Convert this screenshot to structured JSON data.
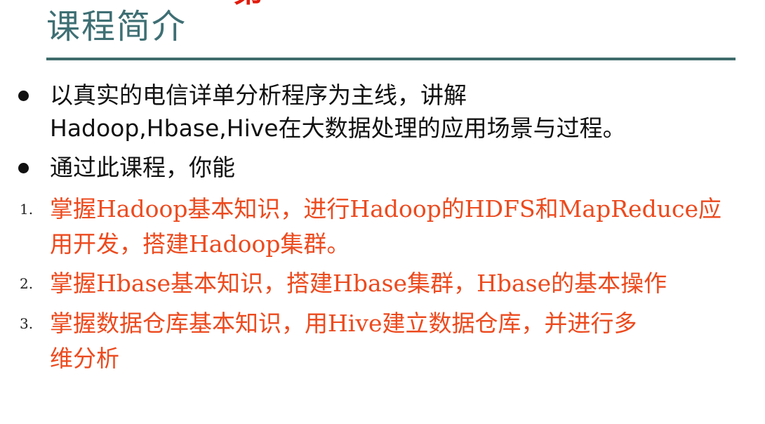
{
  "slide": {
    "top_fragment": "第一",
    "title": "课程简介",
    "bullets": [
      {
        "lines": [
          "以真实的电信详单分析程序为主线，讲解",
          "Hadoop,Hbase,Hive在大数据处理的应用场景与过程。"
        ]
      },
      {
        "lines": [
          "通过此课程，你能"
        ]
      }
    ],
    "numbered": [
      {
        "number": "1.",
        "lines": [
          "掌握Hadoop基本知识，进行Hadoop的HDFS和MapReduce应",
          "用开发，搭建Hadoop集群。"
        ]
      },
      {
        "number": "2.",
        "lines": [
          "掌握Hbase基本知识，搭建Hbase集群，Hbase的基本操作"
        ]
      },
      {
        "number": "3.",
        "lines": [
          "掌握数据仓库基本知识，用Hive建立数据仓库，并进行多",
          "维分析"
        ]
      }
    ],
    "colors": {
      "title": "#3e6f74",
      "rule": "#3f6d6c",
      "body_text": "#111111",
      "highlight_text": "#ec4a1e",
      "top_fragment": "#e11b0c"
    }
  }
}
